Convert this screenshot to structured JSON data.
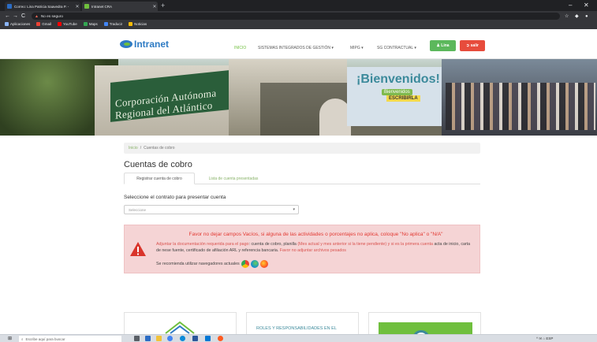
{
  "browser": {
    "tabs": [
      {
        "title": "Correo: Lina Patricia Saavedra P. -",
        "favicon_color": "#2b6cc4"
      },
      {
        "title": "Intranet CRA",
        "favicon_color": "#6fbf3d"
      }
    ],
    "new_tab": "+",
    "window_min": "–",
    "window_close": "✕",
    "back": "←",
    "forward": "→",
    "reload": "C",
    "security_label": "No es seguro",
    "url_host": "",
    "url_path": "",
    "bookmarks": [
      {
        "label": "Aplicaciones",
        "color": "#8ab4f8"
      },
      {
        "label": "Gmail",
        "color": "#ea4335"
      },
      {
        "label": "YouTube",
        "color": "#ff0000"
      },
      {
        "label": "Maps",
        "color": "#34a853"
      },
      {
        "label": "Traducir",
        "color": "#4285f4"
      },
      {
        "label": "Noticias",
        "color": "#fbbc05"
      }
    ]
  },
  "site": {
    "logo": "Intranet",
    "nav": [
      {
        "label": "INICIO",
        "active": true
      },
      {
        "label": "SISTEMAS INTEGRADOS DE GESTIÓN ▾",
        "active": false
      },
      {
        "label": "MIPG ▾",
        "active": false
      },
      {
        "label": "SG CONTRACTUAL ▾",
        "active": false
      }
    ],
    "user_button": "Lina",
    "logout_button": "salir"
  },
  "banner": {
    "sign_line1": "Corporación Autónoma",
    "sign_line2": "Regional del Atlántico",
    "welcome": "¡Bienvenidos!",
    "chip": "Bienvenidos",
    "tag": "ESCRIBIRLA"
  },
  "breadcrumb": {
    "home": "Inicio",
    "sep": "/",
    "current": "Cuentas de cobro"
  },
  "page_title": "Cuentas de cobro",
  "content_tabs": {
    "active": "Registrar cuenta de cobro",
    "other": "Lista de cuenta presentadas"
  },
  "contract_select": {
    "label": "Seleccione el contrato para presentar cuenta",
    "value": "Seleccione"
  },
  "alert": {
    "title": "Favor no dejar campos Vacíos, si alguna de las actividades o porcentajes no aplica, coloque \"No aplica\" o \"N/A\"",
    "body_1": "Adjuntar la ",
    "body_2": "documentación requerida para el pago",
    "body_3": ": cuenta de cobro, planilla ",
    "body_4": "(Mes actual y mes anterior si la tiene pendiente) y si es la primera cuenta",
    "body_5": " acta de inicio, carta de nese fuente, certificado de afiliación ARL y referencia bancaria. ",
    "body_6": "Favor no adjuntar archivos pesados",
    "browsers_note": "Se recomienda utilizar navegadores actuales"
  },
  "cards": [
    {
      "text": ""
    },
    {
      "text": "ROLES Y RESPONSABILIDADES EN EL"
    },
    {
      "text": ""
    }
  ],
  "taskbar": {
    "start": "⊞",
    "search_placeholder": "Escribe aquí para buscar",
    "tray": "^ ✉ ⌂ ESP"
  }
}
